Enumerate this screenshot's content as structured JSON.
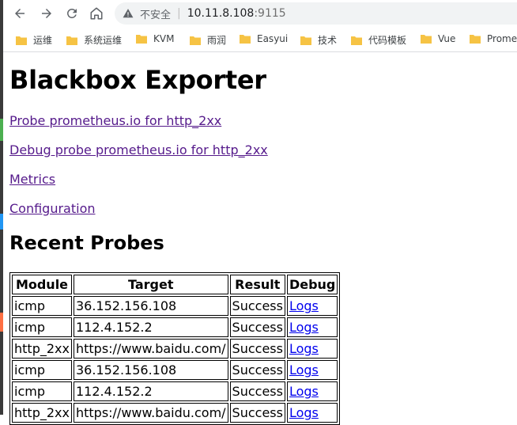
{
  "browser": {
    "security_label": "不安全",
    "url_host": "10.11.8.108",
    "url_port": ":9115"
  },
  "bookmarks": [
    {
      "label": "运维"
    },
    {
      "label": "系统运维"
    },
    {
      "label": "KVM"
    },
    {
      "label": "雨润"
    },
    {
      "label": "Easyui"
    },
    {
      "label": "技术"
    },
    {
      "label": "代码模板"
    },
    {
      "label": "Vue"
    },
    {
      "label": "Prome"
    }
  ],
  "page": {
    "title": "Blackbox Exporter",
    "links": {
      "probe": "Probe prometheus.io for http_2xx",
      "debug_probe": "Debug probe prometheus.io for http_2xx",
      "metrics": "Metrics",
      "configuration": "Configuration"
    },
    "recent_heading": "Recent Probes",
    "table": {
      "headers": [
        "Module",
        "Target",
        "Result",
        "Debug"
      ],
      "rows": [
        [
          "icmp",
          "36.152.156.108",
          "Success",
          "Logs"
        ],
        [
          "icmp",
          "112.4.152.2",
          "Success",
          "Logs"
        ],
        [
          "http_2xx",
          "https://www.baidu.com/",
          "Success",
          "Logs"
        ],
        [
          "icmp",
          "36.152.156.108",
          "Success",
          "Logs"
        ],
        [
          "icmp",
          "112.4.152.2",
          "Success",
          "Logs"
        ],
        [
          "http_2xx",
          "https://www.baidu.com/",
          "Success",
          "Logs"
        ]
      ]
    }
  },
  "colors": {
    "visited_link": "#551a8b",
    "link": "#0000ee",
    "folder": "#f6c344"
  }
}
